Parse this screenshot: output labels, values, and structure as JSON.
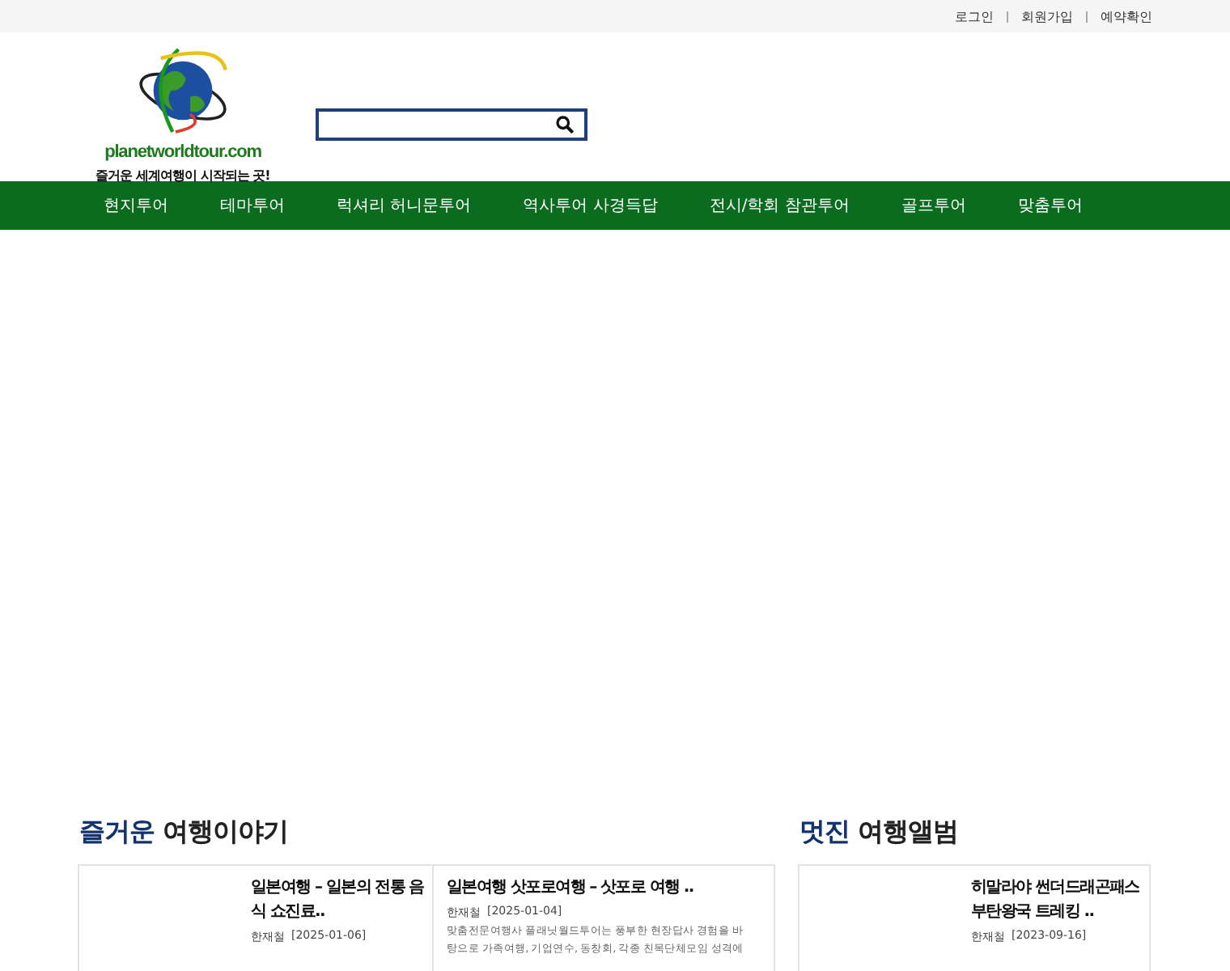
{
  "top_links": [
    "로그인",
    "회원가입",
    "예약확인"
  ],
  "logo": {
    "name": "planetworldtour.com",
    "tagline": "즐거운 세계여행이 시작되는 곳!"
  },
  "nav": [
    "현지투어",
    "테마투어",
    "럭셔리 허니문투어",
    "역사투어 사경득답",
    "전시/학회 참관투어",
    "골프투어",
    "맞춤투어"
  ],
  "stories": {
    "title_accent": "즐거운",
    "title": "여행이야기",
    "posts": [
      {
        "title": "일본여행 – 일본의 전통 음식 쇼진료..",
        "author": "한재철",
        "date": "[2025-01-06]",
        "thumb": true
      },
      {
        "title": "일본여행 삿포로여행 – 삿포로 여행 ..",
        "author": "한재철",
        "date": "[2025-01-04]",
        "excerpt": [
          "맞춤전문여행사 플래닛월드투어는 풍부한 현장답사 경험을 바",
          "탕으로 가족여행, 기업연수, 동창회, 각종 친목단체모임 성격에"
        ],
        "thumb": false
      }
    ]
  },
  "album": {
    "title_accent": "멋진",
    "title": "여행앨범",
    "posts": [
      {
        "title": "히말라야 썬더드래곤패스 부탄왕국 트레킹 ..",
        "author": "한재철",
        "date": "[2023-09-16]",
        "thumb": true
      }
    ]
  }
}
